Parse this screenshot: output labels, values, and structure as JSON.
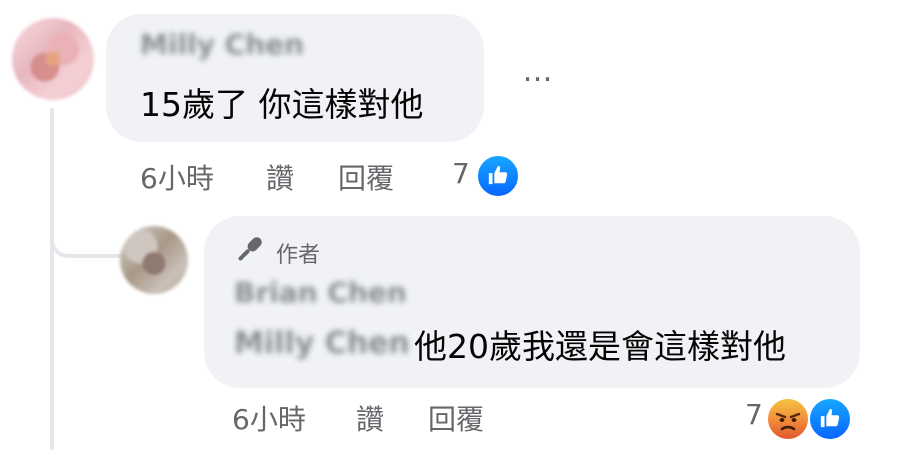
{
  "colors": {
    "bubble_bg": "#f0f2f5",
    "meta_text": "#65676b",
    "like_blue": "#0866ff",
    "thread_line": "#e4e6eb"
  },
  "comment": {
    "author": "Milly Chen",
    "text": "15歲了 你這樣對他",
    "more_icon": "…",
    "time": "6小時",
    "like_action": "讚",
    "reply_action": "回覆",
    "reaction_count": "7",
    "reactions": [
      "like-icon"
    ]
  },
  "reply": {
    "badge_icon": "microphone-icon",
    "badge_label": "作者",
    "author": "Brian Chen",
    "mention": "Milly Chen",
    "text": "他20歲我還是會這樣對他",
    "time": "6小時",
    "like_action": "讚",
    "reply_action": "回覆",
    "reaction_count": "7",
    "reactions": [
      "angry-icon",
      "like-icon"
    ]
  }
}
